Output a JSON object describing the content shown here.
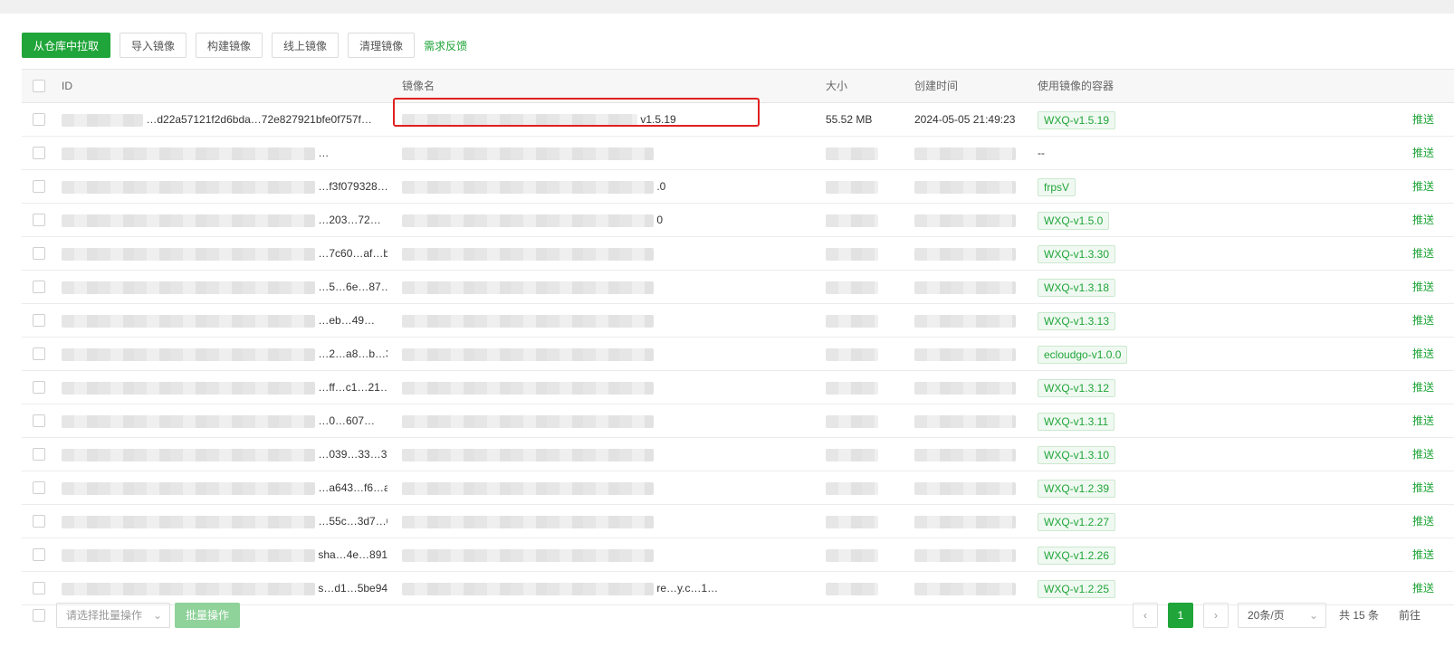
{
  "toolbar": {
    "pull": "从仓库中拉取",
    "import": "导入镜像",
    "build": "构建镜像",
    "online": "线上镜像",
    "clean": "清理镜像",
    "feedback": "需求反馈"
  },
  "table": {
    "headers": {
      "id": "ID",
      "name": "镜像名",
      "size": "大小",
      "created": "创建时间",
      "containers": "使用镜像的容器"
    },
    "push_label": "推送",
    "rows": [
      {
        "id": "…d22a57121f2d6bda…72e827921bfe0f757f…",
        "name": "v1.5.19",
        "size": "55.52 MB",
        "created": "2024-05-05 21:49:23",
        "container": "WXQ-v1.5.19"
      },
      {
        "id": "…",
        "name": "",
        "size": "",
        "created": "",
        "container": "--"
      },
      {
        "id": "…f3f079328…d5d41ca467…4…",
        "name": ".0",
        "size": "",
        "created": "",
        "container": "frpsV"
      },
      {
        "id": "…203…72…",
        "name": "0",
        "size": "",
        "created": "",
        "container": "WXQ-v1.5.0"
      },
      {
        "id": "…7c60…af…b70…04…",
        "name": "",
        "size": "",
        "created": "",
        "container": "WXQ-v1.3.30"
      },
      {
        "id": "…5…6e…87…",
        "name": "",
        "size": "",
        "created": "",
        "container": "WXQ-v1.3.18"
      },
      {
        "id": "…eb…49…",
        "name": "",
        "size": "",
        "created": "",
        "container": "WXQ-v1.3.13"
      },
      {
        "id": "…2…a8…b…33…55c…",
        "name": "",
        "size": "",
        "created": "",
        "container": "ecloudgo-v1.0.0"
      },
      {
        "id": "…ff…c1…21…",
        "name": "",
        "size": "",
        "created": "",
        "container": "WXQ-v1.3.12"
      },
      {
        "id": "…0…607…",
        "name": "",
        "size": "",
        "created": "",
        "container": "WXQ-v1.3.11"
      },
      {
        "id": "…039…33…38…b…",
        "name": "",
        "size": "",
        "created": "",
        "container": "WXQ-v1.3.10"
      },
      {
        "id": "…a643…f6…ac…e…",
        "name": "",
        "size": "",
        "created": "",
        "container": "WXQ-v1.2.39"
      },
      {
        "id": "…55c…3d7…049…31…",
        "name": "",
        "size": "",
        "created": "",
        "container": "WXQ-v1.2.27"
      },
      {
        "id": "sha…4e…891…3…4…",
        "name": "",
        "size": "",
        "created": "",
        "container": "WXQ-v1.2.26"
      },
      {
        "id": "s…d1…5be94…40f…",
        "name": "re…y.c…1…",
        "size": "",
        "created": "",
        "container": "WXQ-v1.2.25"
      }
    ]
  },
  "footer": {
    "batch_select_placeholder": "请选择批量操作",
    "batch_button": "批量操作",
    "prev": "‹",
    "current_page": "1",
    "next": "›",
    "page_size": "20条/页",
    "total": "共 15 条",
    "goto": "前往"
  }
}
